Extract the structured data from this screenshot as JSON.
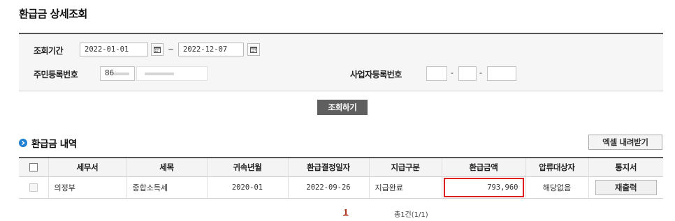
{
  "page": {
    "title": "환급금 상세조회"
  },
  "search": {
    "period_label": "조회기간",
    "start_date": "2022-01-01",
    "tilde": "~",
    "end_date": "2022-12-07",
    "rrn_label": "주민등록번호",
    "rrn_prefix_visible": "86",
    "brn_label": "사업자등록번호",
    "dash": "-",
    "submit_label": "조회하기"
  },
  "section": {
    "title": "환급금 내역",
    "excel_label": "엑셀 내려받기"
  },
  "table": {
    "headers": [
      "세무서",
      "세목",
      "귀속년월",
      "환급결정일자",
      "지급구분",
      "환급금액",
      "압류대상자",
      "통지서"
    ],
    "rows": [
      {
        "tax_office": "의정부",
        "tax_item": "종합소득세",
        "period": "2020-01",
        "decision_date": "2022-09-26",
        "payment_type": "지급완료",
        "amount": "793,960",
        "seizure": "해당없음",
        "notice_button": "재출력"
      }
    ],
    "highlight_color": "#e02020"
  },
  "pagination": {
    "current_page": "1",
    "total_text": "총1건(1/1)"
  },
  "colors": {
    "primary_button": "#5f5f5f",
    "section_icon": "#1f7fd0",
    "page_link": "#b0341a"
  },
  "icons": {
    "calendar": "calendar-icon",
    "section": "arrow-circle-icon"
  }
}
